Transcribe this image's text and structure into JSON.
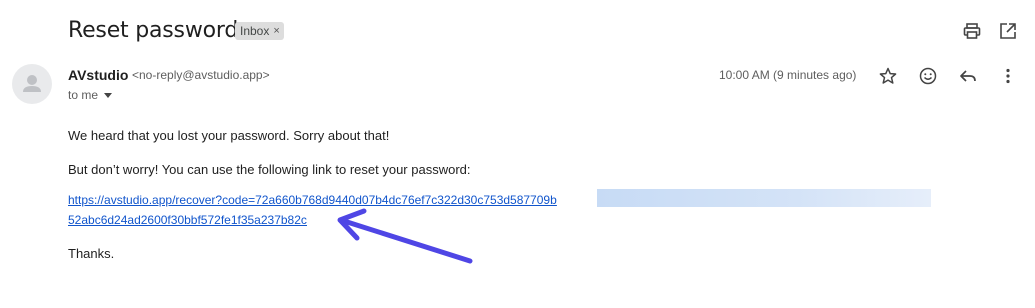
{
  "subject": "Reset password",
  "label": {
    "text": "Inbox",
    "remove_symbol": "×"
  },
  "header_icons": [
    "print-icon",
    "open-in-new-window-icon"
  ],
  "sender": {
    "name": "AVstudio",
    "email": "<no-reply@avstudio.app>",
    "recipient_label": "to me",
    "timestamp": "10:00 AM (9 minutes ago)"
  },
  "actions": [
    "star-icon",
    "emoji-react-icon",
    "reply-icon",
    "more-vertical-icon"
  ],
  "body": {
    "line1": "We heard that you lost your password. Sorry about that!",
    "line2": "But don’t worry! You can use the following link to reset your password:",
    "link_line1": "https://avstudio.app/recover?code=72a660b768d9440d07b4dc76ef7c322d30c753d587709b",
    "link_line2": "52abc6d24ad2600f30bbf572fe1f35a237b82c",
    "closing": "Thanks."
  },
  "colors": {
    "link": "#1155cc",
    "annotation_arrow": "#4f46e5",
    "selection_highlight": "#c7dbf5"
  }
}
